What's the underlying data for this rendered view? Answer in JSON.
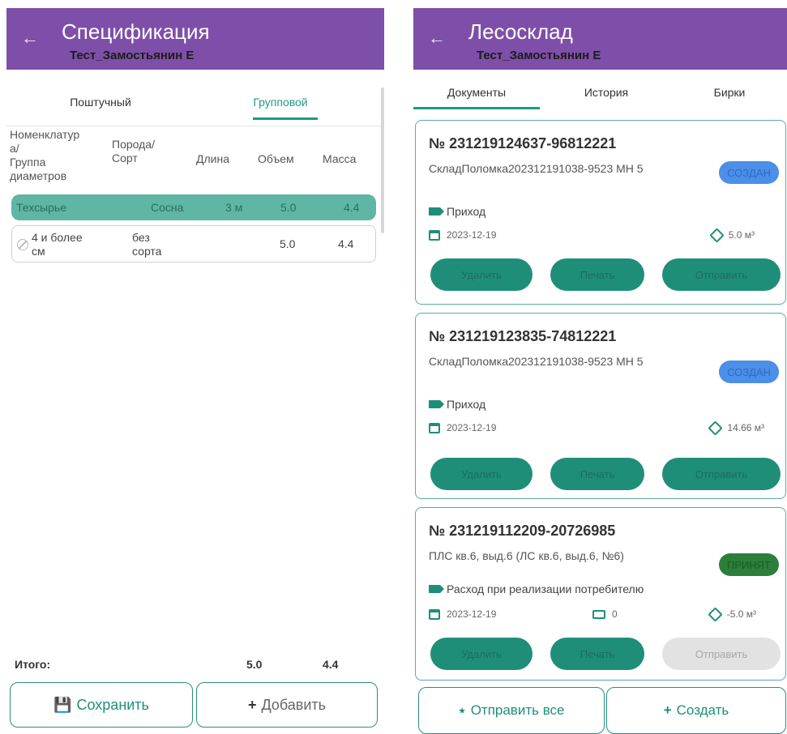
{
  "left": {
    "title": "Спецификация",
    "subtitle": "Тест_Замостьянин Е",
    "tabs": [
      {
        "label": "Поштучный",
        "active": false
      },
      {
        "label": "Групповой",
        "active": true
      }
    ],
    "columns": {
      "nomenclature": [
        "Номенклатур",
        "а/",
        "Группа",
        "диаметров"
      ],
      "breed": [
        "Порода/",
        "Сорт"
      ],
      "length": "Длина",
      "volume": "Объем",
      "mass": "Масса"
    },
    "group_row": {
      "name": "Техсырье",
      "breed": "Сосна",
      "length": "3 м",
      "volume": "5.0",
      "mass": "4.4"
    },
    "item_row": {
      "name": [
        "4 и более",
        "см"
      ],
      "grade": [
        "без",
        "сорта"
      ],
      "volume": "5.0",
      "mass": "4.4"
    },
    "totals": {
      "label": "Итого:",
      "volume": "5.0",
      "mass": "4.4"
    },
    "buttons": {
      "save": "Сохранить",
      "add": "Добавить"
    }
  },
  "right": {
    "title": "Лесосклад",
    "subtitle": "Тест_Замостьянин Е",
    "tabs": [
      {
        "label": "Документы",
        "active": true
      },
      {
        "label": "История",
        "active": false
      },
      {
        "label": "Бирки",
        "active": false
      }
    ],
    "cards": [
      {
        "number": "№ 231219124637-96812221",
        "description": "СкладПоломка202312191038-9523 МН 5",
        "status": "СОЗДАН",
        "type": "Приход",
        "date": "2023-12-19",
        "volume": "5.0 м³",
        "buttons": {
          "delete": "Удалить",
          "print": "Печать",
          "send": "Отправить"
        }
      },
      {
        "number": "№ 231219123835-74812221",
        "description": "СкладПоломка202312191038-9523 МН 5",
        "status": "СОЗДАН",
        "type": "Приход",
        "date": "2023-12-19",
        "volume": "14.66 м³",
        "buttons": {
          "delete": "Удалить",
          "print": "Печать",
          "send": "Отправить"
        }
      },
      {
        "number": "№ 231219112209-20726985",
        "description": "ПЛС кв.6, выд.6 (ЛС кв.6, выд.6, №6)",
        "status": "ПРИНЯТ",
        "type": "Расход при реализации потребителю",
        "date": "2023-12-19",
        "print_count": "0",
        "volume": "-5.0 м³",
        "buttons": {
          "delete": "Удалить",
          "print": "Печать",
          "send": "Отправить"
        }
      }
    ],
    "buttons": {
      "send_all": "Отправить все",
      "create": "Создать"
    }
  },
  "colors": {
    "appbar": "#7e4fa8",
    "accent": "#1f8e79",
    "group_row": "#5fb6a4",
    "badge_created": "#4b8fe8",
    "badge_accepted": "#2b7f3a"
  }
}
